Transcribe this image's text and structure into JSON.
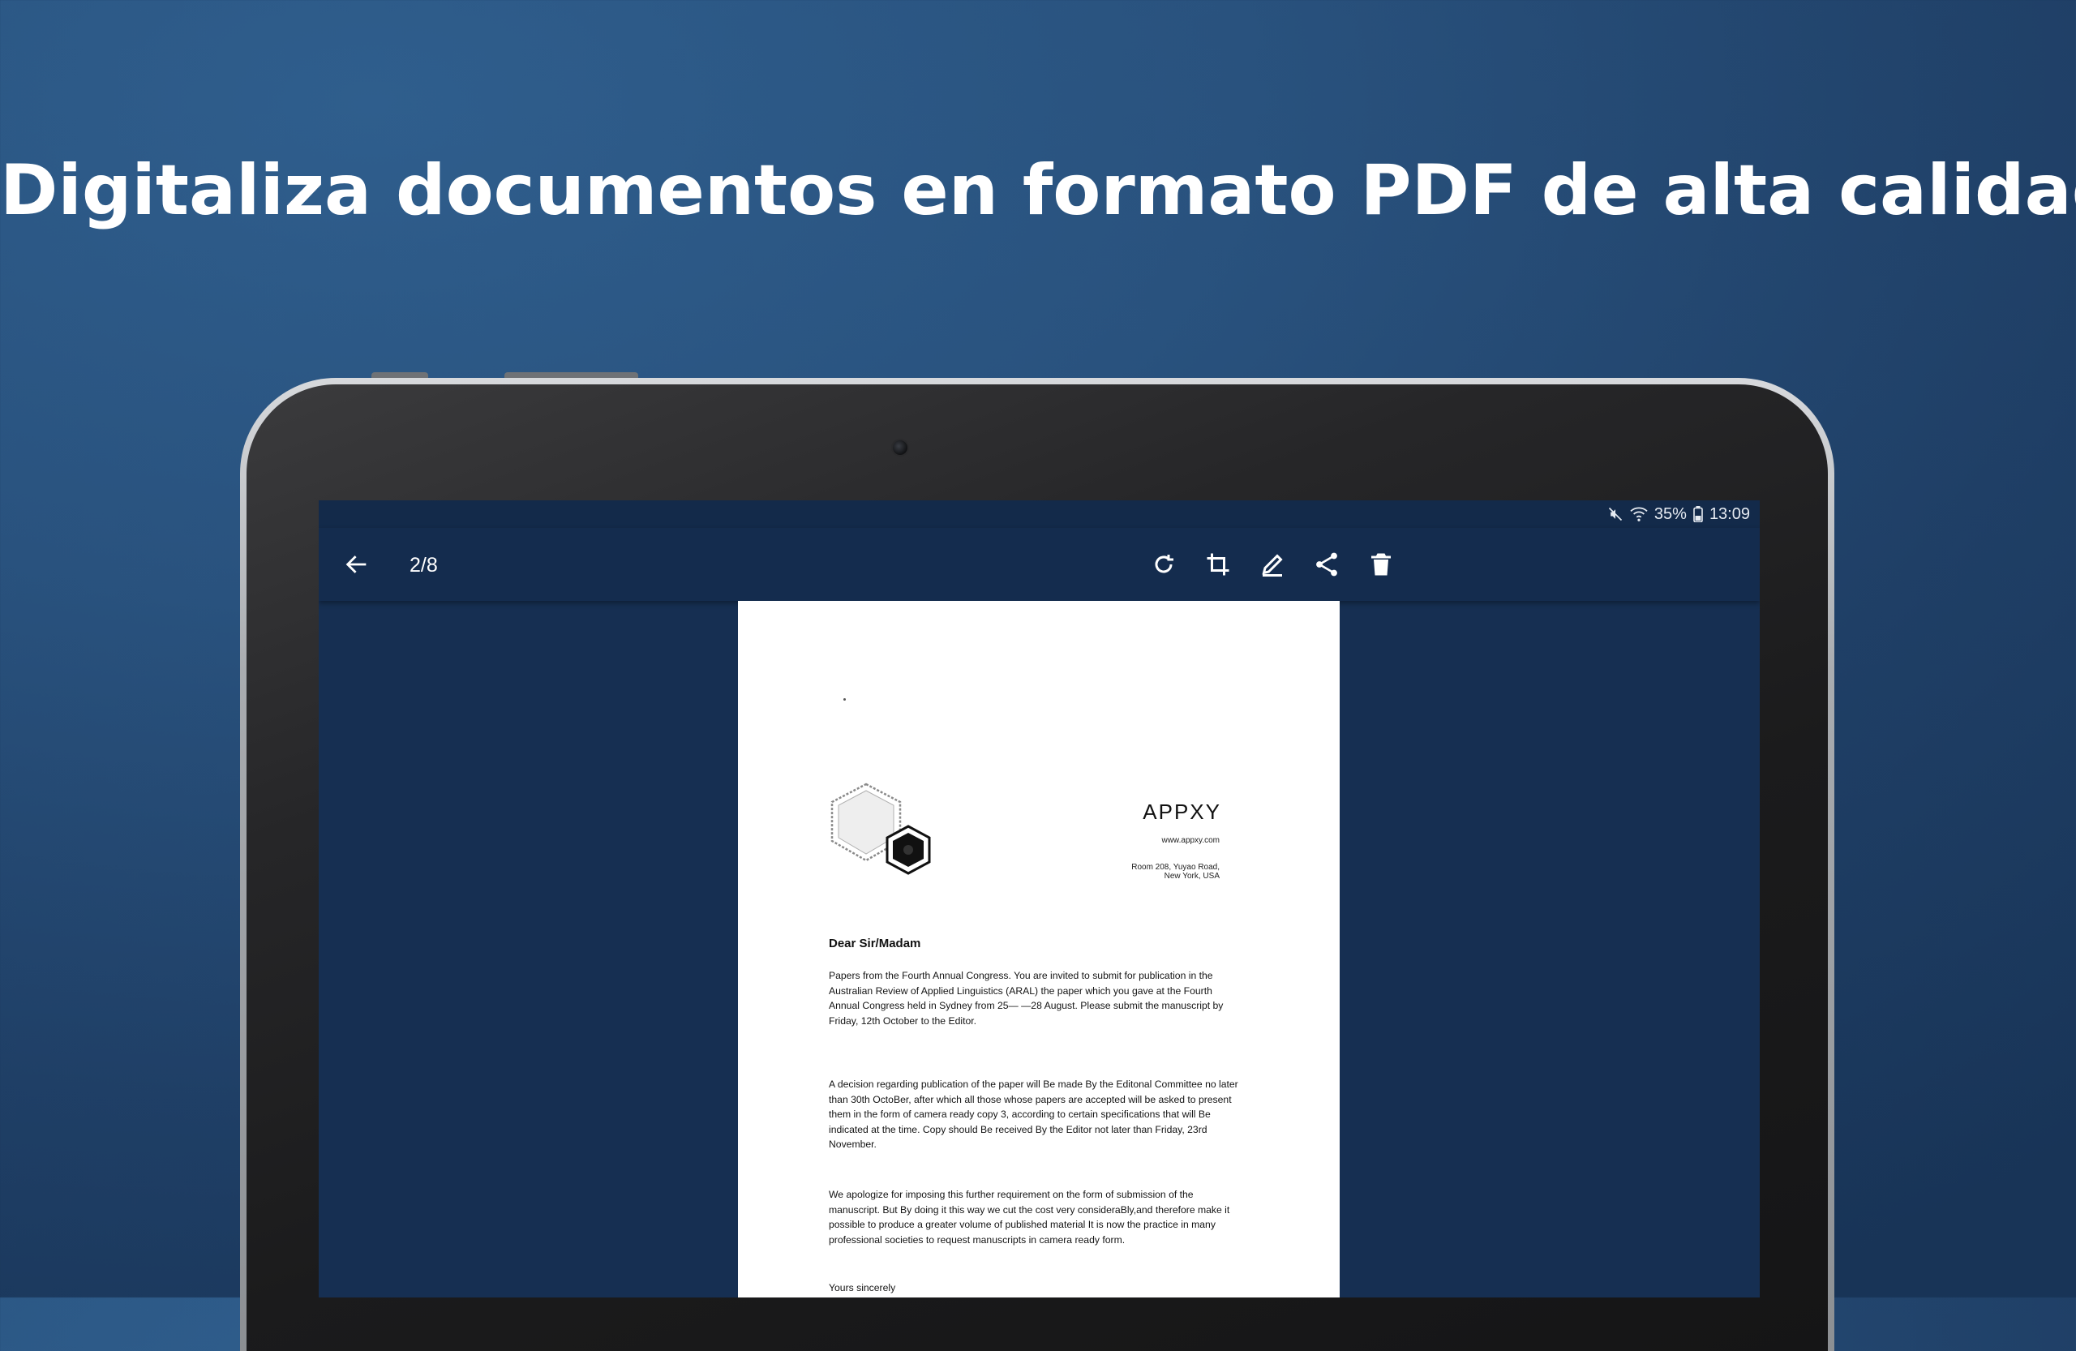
{
  "headline": "Digitaliza documentos en formato PDF de alta calidad.",
  "status_bar": {
    "battery_percent": "35%",
    "time": "13:09",
    "icons": [
      "mute-icon",
      "wifi-icon",
      "battery-icon"
    ]
  },
  "app_bar": {
    "page_indicator": "2/8",
    "back_icon": "arrow-left-icon",
    "actions": [
      "rotate-icon",
      "crop-icon",
      "edit-icon",
      "share-icon",
      "delete-icon"
    ]
  },
  "document": {
    "brand": "APPXY",
    "website": "www.appxy.com",
    "address_line1": "Room 208, Yuyao Road,",
    "address_line2": "New York, USA",
    "salutation": "Dear Sir/Madam",
    "paragraph1": "Papers from the Fourth Annual Congress. You are invited to submit for publication in the Australian Review of Applied Linguistics (ARAL) the paper which you gave at the Fourth Annual Congress held in Sydney from 25— —28 August. Please submit the manuscript by Friday, 12th October to the Editor.",
    "paragraph2": "A decision regarding publication of the paper will Be made By the Editonal Committee no later than 30th OctoBer, after which all those whose papers are accepted will be asked to present them in the form of camera ready copy 3, according to certain specifications that will Be indicated at the time. Copy should Be received By the Editor not later than Friday, 23rd November.",
    "paragraph3": "We apologize for imposing this further requirement on the form of submission of the manuscript. But By doing it this way we cut the cost very consideraBly,and therefore make it possible to produce a greater volume of published material It is now the practice in many professional societies to request manuscripts in camera ready form.",
    "closing": "Yours sincerely"
  },
  "colors": {
    "background": "#29527e",
    "screen": "#162f52",
    "app_bar": "#142c4e",
    "paper": "#ffffff"
  }
}
